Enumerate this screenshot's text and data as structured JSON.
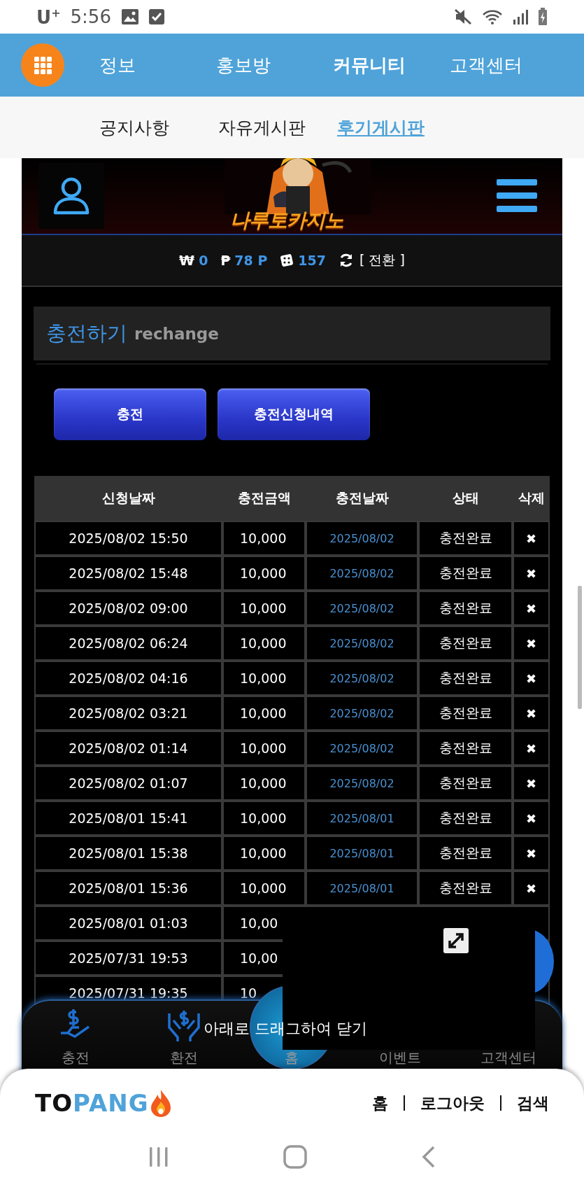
{
  "status_bar": {
    "carrier": "U$^{+}$",
    "time": "5:56"
  },
  "nav": {
    "items": [
      {
        "label": "정보",
        "selected": false
      },
      {
        "label": "홍보방",
        "selected": false
      },
      {
        "label": "커뮤니티",
        "selected": true
      },
      {
        "label": "고객센터",
        "selected": false
      }
    ]
  },
  "sub_nav": {
    "items": [
      {
        "label": "공지사항",
        "selected": false
      },
      {
        "label": "자유게시판",
        "selected": false
      },
      {
        "label": "후기게시판",
        "selected": true
      }
    ]
  },
  "header": {
    "logo": "나루토카지노"
  },
  "balance": {
    "items": [
      {
        "kind": "won",
        "symbol": "₩",
        "value": "0"
      },
      {
        "kind": "point",
        "symbol": "₱",
        "value": "78 P"
      },
      {
        "kind": "dice",
        "value": "157"
      }
    ],
    "switch": "[ 전환 ]"
  },
  "section": {
    "title": "충전하기",
    "subtitle": "rechange"
  },
  "buttons": [
    "충전",
    "충전신청내역"
  ],
  "table": {
    "columns": [
      "신청날짜",
      "충전금액",
      "충전날짜",
      "상태",
      "삭제"
    ],
    "rows": [
      [
        "2025/08/02 15:50",
        "10,000",
        "2025/08/02",
        "충전완료",
        "✖"
      ],
      [
        "2025/08/02 15:48",
        "10,000",
        "2025/08/02",
        "충전완료",
        "✖"
      ],
      [
        "2025/08/02 09:00",
        "10,000",
        "2025/08/02",
        "충전완료",
        "✖"
      ],
      [
        "2025/08/02 06:24",
        "10,000",
        "2025/08/02",
        "충전완료",
        "✖"
      ],
      [
        "2025/08/02 04:16",
        "10,000",
        "2025/08/02",
        "충전완료",
        "✖"
      ],
      [
        "2025/08/02 03:21",
        "10,000",
        "2025/08/02",
        "충전완료",
        "✖"
      ],
      [
        "2025/08/02 01:14",
        "10,000",
        "2025/08/02",
        "충전완료",
        "✖"
      ],
      [
        "2025/08/02 01:07",
        "10,000",
        "2025/08/02",
        "충전완료",
        "✖"
      ],
      [
        "2025/08/01 15:41",
        "10,000",
        "2025/08/01",
        "충전완료",
        "✖"
      ],
      [
        "2025/08/01 15:38",
        "10,000",
        "2025/08/01",
        "충전완료",
        "✖"
      ],
      [
        "2025/08/01 15:36",
        "10,000",
        "2025/08/01",
        "충전완료",
        "✖"
      ],
      [
        "2025/08/01 01:03",
        "10,00"
      ],
      [
        "2025/07/31 19:53",
        "10,00"
      ],
      [
        "2025/07/31 19:35",
        "10"
      ]
    ]
  },
  "bottom_nav": {
    "items": [
      {
        "kind": "hand",
        "label": "충전"
      },
      {
        "kind": "hands",
        "label": "환전"
      },
      {
        "kind": "center",
        "label": "홈"
      },
      {
        "kind": "plain",
        "label": "이벤트"
      },
      {
        "kind": "plain",
        "label": "고객센터"
      }
    ]
  },
  "video_popup": {
    "hint": "아래로 드래그하여 닫기"
  },
  "footer": {
    "logo": [
      "TO",
      "PANG"
    ],
    "links": [
      "홈",
      "로그아웃",
      "검색"
    ]
  }
}
